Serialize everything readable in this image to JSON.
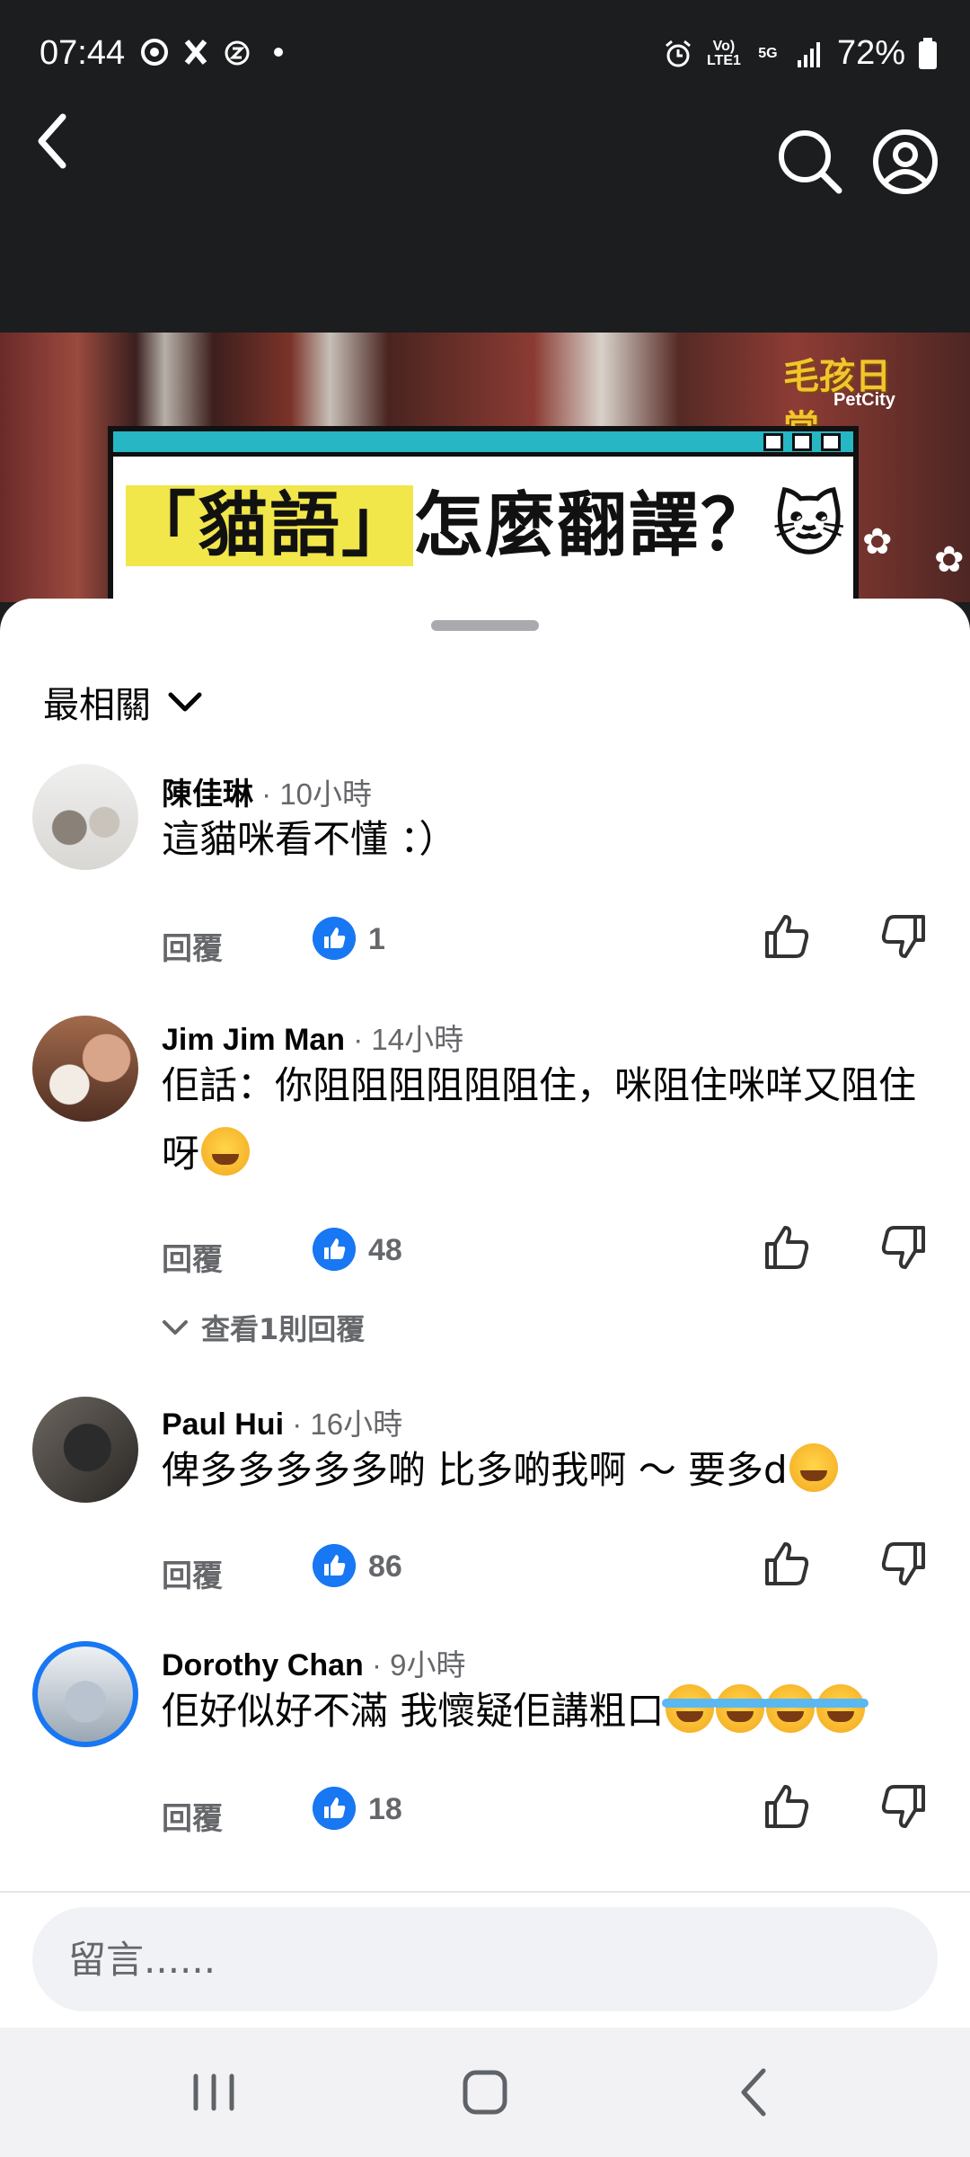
{
  "status_bar": {
    "time": "07:44",
    "network_label": "Vo) LTE1",
    "network_type": "5G",
    "battery": "72%"
  },
  "video": {
    "title_highlight": "「貓語」",
    "title_rest": "怎麼翻譯？",
    "logo_text": "毛孩日常",
    "logo_subtext": "PetCity"
  },
  "sheet": {
    "sort_label": "最相關"
  },
  "comments": [
    {
      "author": "陳佳琳",
      "time": " · 10小時",
      "text": "這貓咪看不懂 ：）",
      "reply_label": "回覆",
      "likes": "1"
    },
    {
      "author": "Jim Jim Man",
      "time": " · 14小時",
      "text": "佢話：你阻阻阻阻阻阻住，咪阻住咪咩又阻住呀",
      "reply_label": "回覆",
      "likes": "48",
      "view_replies": "查看1則回覆"
    },
    {
      "author": "Paul Hui",
      "time": " · 16小時",
      "text": "俾多多多多多啲 比多啲我啊 ～ 要多d",
      "reply_label": "回覆",
      "likes": "86"
    },
    {
      "author": "Dorothy Chan",
      "time": " · 9小時",
      "text": "佢好似好不滿 我懷疑佢講粗口",
      "reply_label": "回覆",
      "likes": "18"
    }
  ],
  "input": {
    "placeholder": "留言......"
  },
  "colors": {
    "accent": "#1877f2",
    "secondary_text": "#65676b",
    "app_bar": "#1c1d1f"
  }
}
